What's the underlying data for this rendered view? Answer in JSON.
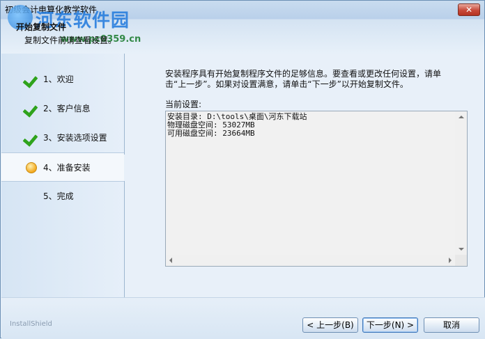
{
  "window": {
    "title": "初级会计电算化教学软件",
    "close_label": "✕"
  },
  "watermark": {
    "text": "河东软件园",
    "url": "www.pc0359.cn"
  },
  "header": {
    "title": "开始复制文件",
    "subtitle": "复制文件前请查看设置。"
  },
  "nav": {
    "items": [
      {
        "label": "1、欢迎",
        "state": "done"
      },
      {
        "label": "2、客户信息",
        "state": "done"
      },
      {
        "label": "3、安装选项设置",
        "state": "done"
      },
      {
        "label": "4、准备安装",
        "state": "current"
      },
      {
        "label": "5、完成",
        "state": "pending"
      }
    ]
  },
  "main": {
    "description": "安装程序具有开始复制程序文件的足够信息。要查看或更改任何设置，请单击“上一步”。如果对设置满意，请单击“下一步”以开始复制文件。",
    "current_settings_label": "当前设置:",
    "settings_lines": [
      "安装目录: D:\\tools\\桌面\\河东下载站",
      "物理磁盘空间: 53027MB",
      "可用磁盘空间: 23664MB"
    ]
  },
  "footer": {
    "brand": "InstallShield",
    "back_label": "< 上一步(B)",
    "next_label": "下一步(N) >",
    "cancel_label": "取消"
  },
  "colors": {
    "check": "#2fa31c",
    "current_dot": "#f2a81d",
    "close_button": "#c8493a"
  }
}
